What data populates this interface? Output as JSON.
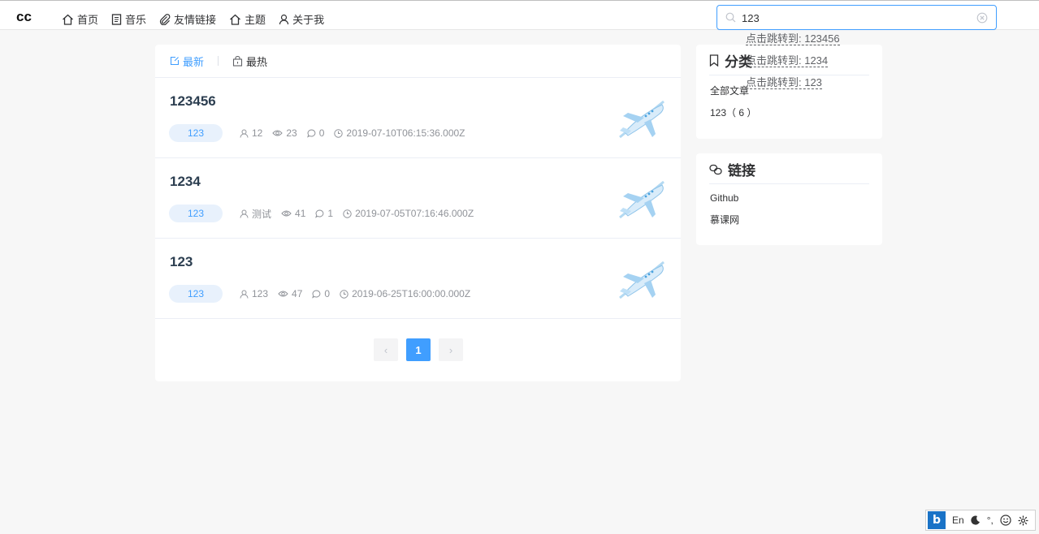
{
  "header": {
    "logo": "cc",
    "nav": [
      {
        "label": "首页",
        "icon": "home-icon"
      },
      {
        "label": "音乐",
        "icon": "document-icon"
      },
      {
        "label": "友情链接",
        "icon": "paperclip-icon"
      },
      {
        "label": "主题",
        "icon": "home-icon"
      },
      {
        "label": "关于我",
        "icon": "user-icon"
      }
    ],
    "search": {
      "value": "123",
      "suggestions": [
        "点击跳转到: 123456",
        "点击跳转到: 1234",
        "点击跳转到: 123"
      ]
    }
  },
  "main": {
    "tabs": [
      {
        "label": "最新",
        "active": true
      },
      {
        "label": "最热",
        "active": false
      }
    ],
    "articles": [
      {
        "title": "123456",
        "tag": "123",
        "author": "12",
        "views": "23",
        "comments": "0",
        "date": "2019-07-10T06:15:36.000Z"
      },
      {
        "title": "1234",
        "tag": "123",
        "author": "测试",
        "views": "41",
        "comments": "1",
        "date": "2019-07-05T07:16:46.000Z"
      },
      {
        "title": "123",
        "tag": "123",
        "author": "123",
        "views": "47",
        "comments": "0",
        "date": "2019-06-25T16:00:00.000Z"
      }
    ],
    "pagination": {
      "prev": "‹",
      "current": "1",
      "next": "›"
    }
  },
  "sidebar": {
    "categories": {
      "title": "分类",
      "items": [
        "全部文章",
        "123（ 6 ）"
      ]
    },
    "links": {
      "title": "链接",
      "items": [
        "Github",
        "慕课网"
      ]
    }
  },
  "ime": {
    "logo": "b",
    "lang": "En",
    "punct": "°,"
  },
  "colors": {
    "accent": "#409eff",
    "tag_bg": "#e8f1fc",
    "page_bg": "#f7f7f7"
  }
}
